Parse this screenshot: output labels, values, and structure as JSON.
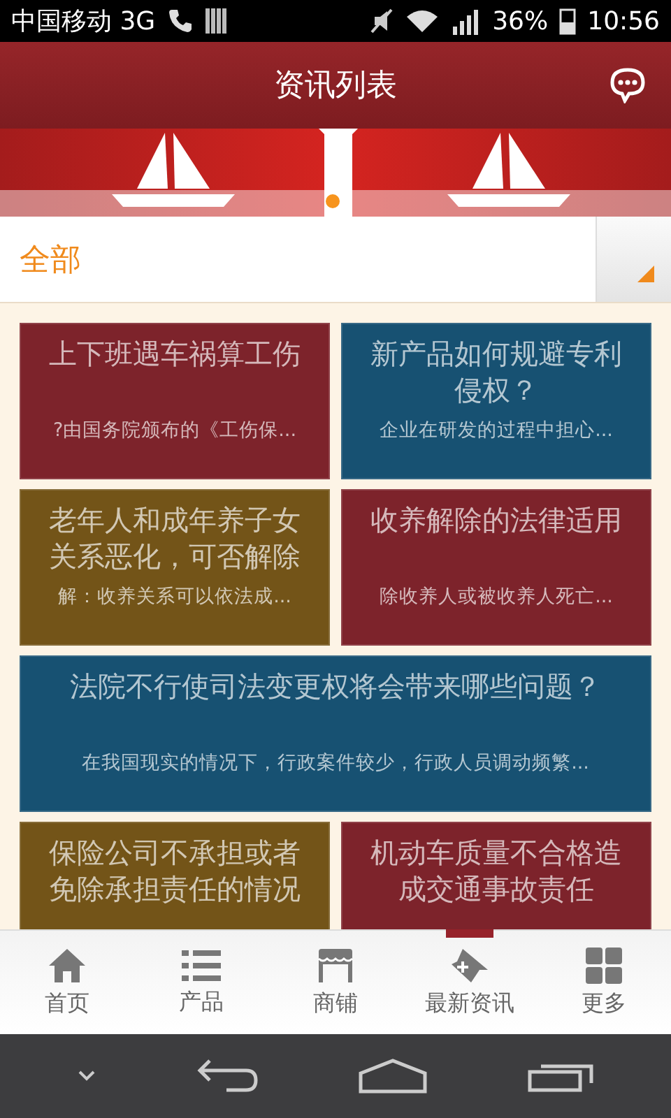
{
  "status_bar": {
    "carrier": "中国移动 3G",
    "battery": "36%",
    "time": "10:56"
  },
  "header": {
    "title": "资讯列表"
  },
  "filter": {
    "value": "全部"
  },
  "cards": [
    {
      "kind": "half",
      "color": "#7d232b",
      "title": "上下班遇车祸算工伤",
      "snippet": "?由国务院颁布的《工伤保..."
    },
    {
      "kind": "half",
      "color": "#175172",
      "title": "新产品如何规避专利侵权？",
      "snippet": "企业在研发的过程中担心..."
    },
    {
      "kind": "half",
      "color": "#735418",
      "title": "老年人和成年养子女关系恶化，可否解除",
      "snippet": "解：收养关系可以依法成..."
    },
    {
      "kind": "half",
      "color": "#7d232b",
      "title": "收养解除的法律适用",
      "snippet": "除收养人或被收养人死亡..."
    },
    {
      "kind": "wide",
      "color": "#175172",
      "title": "法院不行使司法变更权将会带来哪些问题？",
      "snippet": "在我国现实的情况下，行政案件较少，行政人员调动频繁..."
    },
    {
      "kind": "half",
      "color": "#735418",
      "title": "保险公司不承担或者免除承担责任的情况"
    },
    {
      "kind": "half",
      "color": "#7d232b",
      "title": "机动车质量不合格造成交通事故责任"
    }
  ],
  "tabs": [
    {
      "label": "首页",
      "kind": "home",
      "selected": false
    },
    {
      "label": "产品",
      "kind": "list",
      "selected": false
    },
    {
      "label": "商铺",
      "kind": "shop",
      "selected": false
    },
    {
      "label": "最新资讯",
      "kind": "news",
      "selected": true
    },
    {
      "label": "更多",
      "kind": "grid",
      "selected": false
    }
  ]
}
